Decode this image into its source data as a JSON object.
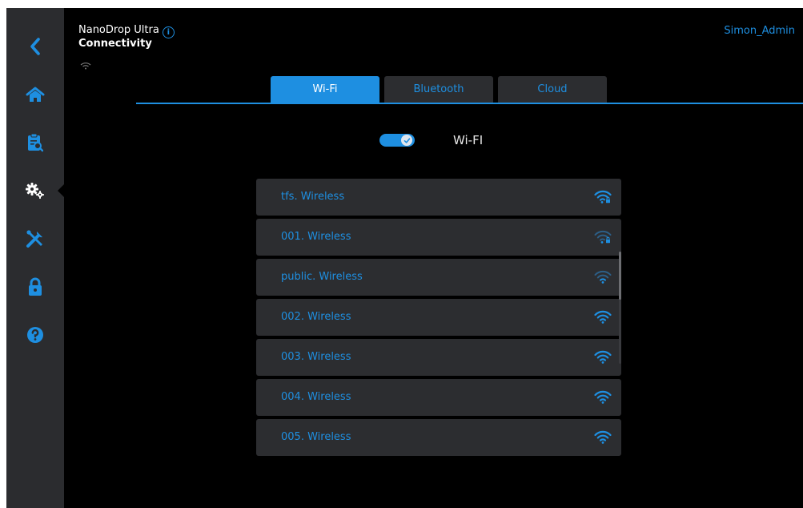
{
  "header": {
    "app_name": "NanoDrop Ultra",
    "page_title": "Connectivity",
    "user": "Simon_Admin"
  },
  "sidebar": {
    "items": [
      {
        "icon": "back-icon"
      },
      {
        "icon": "home-icon"
      },
      {
        "icon": "clipboard-search-icon"
      },
      {
        "icon": "settings-gears-icon",
        "active": true
      },
      {
        "icon": "tools-icon"
      },
      {
        "icon": "lock-icon"
      },
      {
        "icon": "help-icon"
      }
    ]
  },
  "tabs": [
    {
      "label": "Wi-Fi",
      "active": true
    },
    {
      "label": "Bluetooth",
      "active": false
    },
    {
      "label": "Cloud",
      "active": false
    }
  ],
  "wifi_toggle": {
    "label": "Wi-FI",
    "on": true
  },
  "networks": [
    {
      "name": "tfs. Wireless",
      "secured": true,
      "strength": "full"
    },
    {
      "name": "001. Wireless",
      "secured": true,
      "strength": "weak"
    },
    {
      "name": "public. Wireless",
      "secured": false,
      "strength": "weak"
    },
    {
      "name": "002. Wireless",
      "secured": false,
      "strength": "full"
    },
    {
      "name": "003. Wireless",
      "secured": false,
      "strength": "full"
    },
    {
      "name": "004. Wireless",
      "secured": false,
      "strength": "full"
    },
    {
      "name": "005. Wireless",
      "secured": false,
      "strength": "full"
    }
  ],
  "colors": {
    "accent": "#1e8fe1",
    "background": "#000000",
    "sidebar": "#2b2c2f",
    "row": "#2c2d30"
  }
}
